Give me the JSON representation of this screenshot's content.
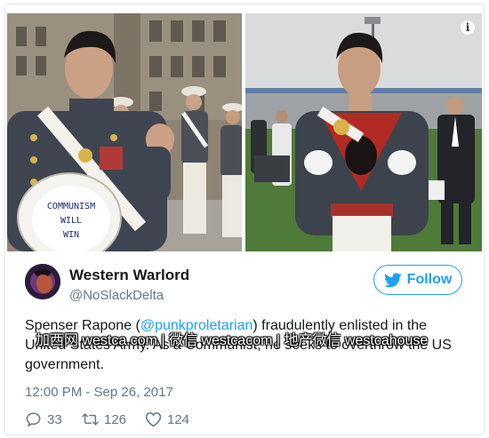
{
  "photos": {
    "left": {
      "cap_text": [
        "COMMUNISM",
        "WILL",
        "WIN"
      ]
    },
    "right": {}
  },
  "info_icon": {
    "glyph": "i"
  },
  "author": {
    "name": "Western Warlord",
    "handle": "@NoSlackDelta"
  },
  "follow_button": {
    "label": "Follow"
  },
  "tweet": {
    "text_before": "Spenser Rapone (",
    "mention": "@punkproletarian",
    "text_after": ") fraudulently enlisted in the United States Army. As a Communist, he seeks to overthrow the US government.",
    "timestamp": "12:00 PM - Sep 26, 2017"
  },
  "actions": {
    "replies": "33",
    "retweets": "126",
    "likes": "124"
  },
  "watermark": "加西网 westca.com | 微信 westcacom | 地产微信 westcahouse",
  "icons": {
    "info": "info-icon",
    "follow": "twitter-bird-icon",
    "reply": "reply-icon",
    "retweet": "retweet-icon",
    "like": "heart-icon"
  },
  "colors": {
    "link": "#1da1f2",
    "text": "#14171a",
    "muted": "#657786",
    "border": "#e1e8ed"
  }
}
